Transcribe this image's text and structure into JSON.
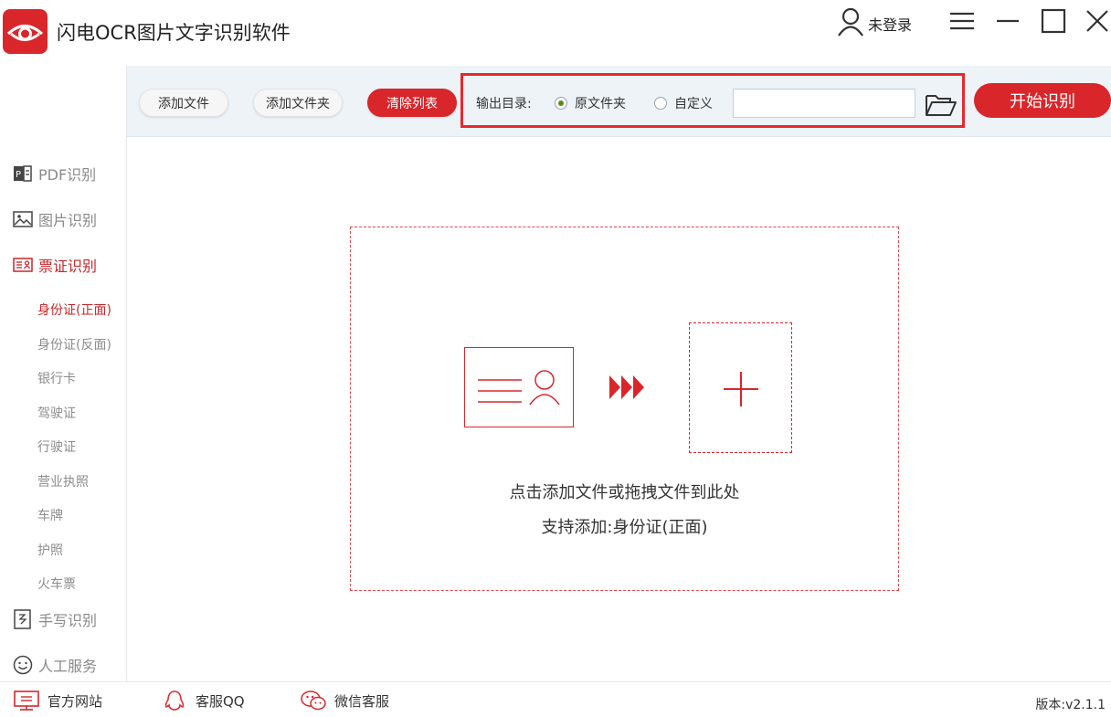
{
  "app": {
    "title": "闪电OCR图片文字识别软件",
    "user_label": "未登录"
  },
  "toolbar": {
    "add_file": "添加文件",
    "add_folder": "添加文件夹",
    "clear_list": "清除列表",
    "output_label": "输出目录:",
    "option_original": "原文件夹",
    "option_custom": "自定义",
    "selected_option": "原文件夹",
    "path_value": "",
    "start": "开始识别"
  },
  "sidebar": {
    "items": [
      {
        "label": "PDF识别",
        "icon": "pdf-icon"
      },
      {
        "label": "图片识别",
        "icon": "image-icon"
      },
      {
        "label": "票证识别",
        "icon": "certificate-icon",
        "active": true
      },
      {
        "label": "手写识别",
        "icon": "handwriting-icon"
      },
      {
        "label": "人工服务",
        "icon": "smiley-icon"
      }
    ],
    "sub_items": [
      "身份证(正面)",
      "身份证(反面)",
      "银行卡",
      "驾驶证",
      "行驶证",
      "营业执照",
      "车牌",
      "护照",
      "火车票"
    ],
    "active_sub": "身份证(正面)"
  },
  "main": {
    "hint_drop": "点击添加文件或拖拽文件到此处",
    "hint_support": "支持添加:身份证(正面)"
  },
  "footer": {
    "website": "官方网站",
    "qq": "客服QQ",
    "wechat": "微信客服",
    "version": "版本:v2.1.1"
  },
  "colors": {
    "accent": "#d9262b",
    "toolbar_bg": "#eef3f8"
  }
}
